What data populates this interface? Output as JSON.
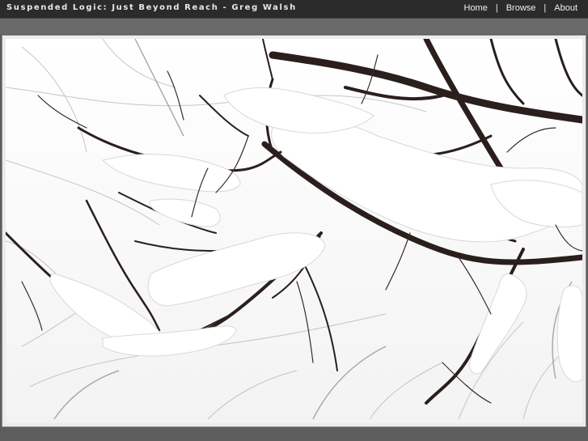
{
  "header": {
    "site_title": "Suspended Logic: Just Beyond Reach - Greg Walsh",
    "nav": [
      {
        "label": "Home"
      },
      {
        "label": "Browse"
      },
      {
        "label": "About"
      }
    ],
    "separator": "|"
  },
  "photo": {
    "subject": "snow-covered tree branches against white sky"
  },
  "colors": {
    "topbar": "#2b2b2b",
    "page_background": "#5d5d5d",
    "frame": "#ececec",
    "branch": "#2a1f1c",
    "snow": "#ffffff"
  }
}
